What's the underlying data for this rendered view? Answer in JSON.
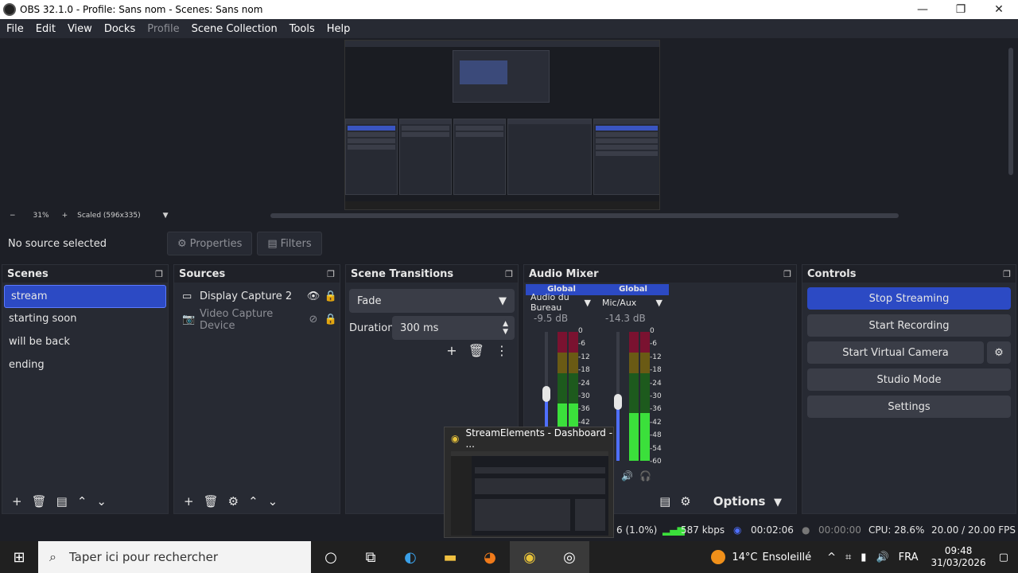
{
  "window": {
    "title": "OBS 32.1.0 - Profile: Sans nom - Scenes: Sans nom",
    "controls": [
      "—",
      "❐",
      "✕"
    ]
  },
  "menu": {
    "items": [
      "File",
      "Edit",
      "View",
      "Docks",
      "Profile",
      "Scene Collection",
      "Tools",
      "Help"
    ]
  },
  "preview": {
    "zoom_out": "−",
    "zoom_level": "31%",
    "zoom_in": "+",
    "scale_label": "Scaled (596x335)",
    "dropdown": "▼"
  },
  "context": {
    "no_source": "No source selected",
    "properties": "Properties",
    "filters": "Filters"
  },
  "scenes": {
    "title": "Scenes",
    "items": [
      "stream",
      "starting soon",
      "will be back",
      "ending"
    ],
    "selected_index": 0
  },
  "sources": {
    "title": "Sources",
    "items": [
      {
        "name": "Display Capture 2",
        "icon": "monitor-icon",
        "visible": true
      },
      {
        "name": "Video Capture Device",
        "icon": "camera-icon",
        "visible": false
      }
    ]
  },
  "transitions": {
    "title": "Scene Transitions",
    "selected": "Fade",
    "duration_label": "Duration",
    "duration_value": "300 ms"
  },
  "mixer": {
    "title": "Audio Mixer",
    "channels": [
      {
        "badge": "Global",
        "name": "Audio du Bureau",
        "db": "-9.5 dB",
        "level": 0.72
      },
      {
        "badge": "Global",
        "name": "Mic/Aux",
        "db": "-14.3 dB",
        "level": 0.6
      }
    ],
    "scale": [
      "0",
      "-6",
      "-12",
      "-18",
      "-24",
      "-30",
      "-36",
      "-42",
      "-48",
      "-54",
      "-60"
    ],
    "options_label": "Options"
  },
  "controls": {
    "title": "Controls",
    "stop_streaming": "Stop Streaming",
    "start_recording": "Start Recording",
    "start_virtual_camera": "Start Virtual Camera",
    "studio_mode": "Studio Mode",
    "settings": "Settings"
  },
  "status": {
    "dropped": "6 (1.0%)",
    "bitrate": "587 kbps",
    "stream_time": "00:02:06",
    "rec_time": "00:00:00",
    "cpu": "CPU: 28.6%",
    "fps": "20.00 / 20.00 FPS"
  },
  "popup": {
    "title": "StreamElements - Dashboard - ..."
  },
  "taskbar": {
    "search_placeholder": "Taper ici pour rechercher",
    "weather_temp": "14°C",
    "weather_text": "Ensoleillé",
    "lang": "FRA",
    "time": "09:48",
    "date": "31/03/2026"
  },
  "colors": {
    "accent": "#2c4ac4",
    "dock_bg": "#272a33",
    "app_bg": "#1d1f26"
  }
}
